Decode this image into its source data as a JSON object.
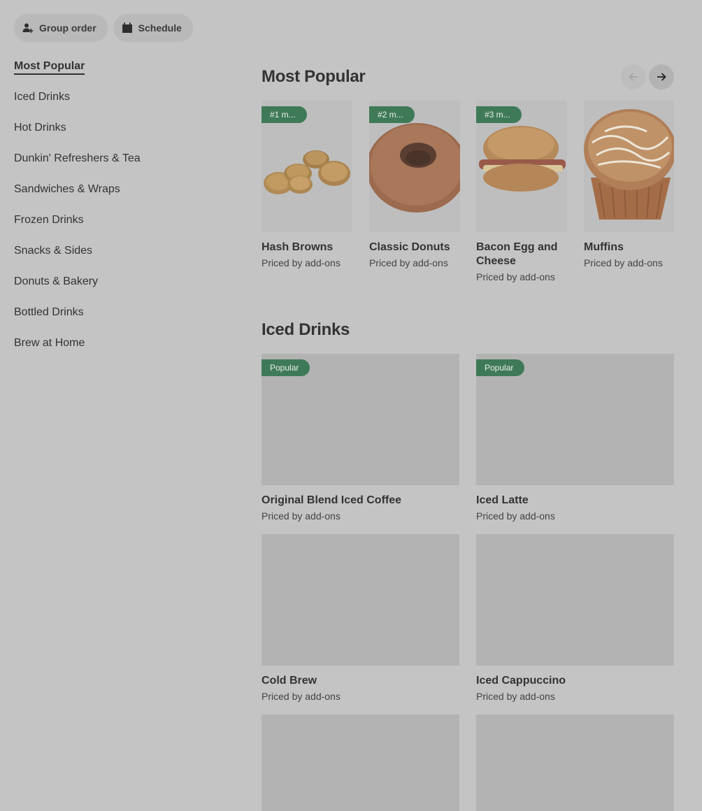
{
  "top_actions": {
    "group_order": "Group order",
    "schedule": "Schedule"
  },
  "sidebar": {
    "items": [
      {
        "label": "Most Popular"
      },
      {
        "label": "Iced Drinks"
      },
      {
        "label": "Hot Drinks"
      },
      {
        "label": "Dunkin' Refreshers & Tea"
      },
      {
        "label": "Sandwiches & Wraps"
      },
      {
        "label": "Frozen Drinks"
      },
      {
        "label": "Snacks & Sides"
      },
      {
        "label": "Donuts & Bakery"
      },
      {
        "label": "Bottled Drinks"
      },
      {
        "label": "Brew at Home"
      }
    ]
  },
  "most_popular": {
    "title": "Most Popular",
    "items": [
      {
        "badge": "#1 m...",
        "name": "Hash Browns",
        "price": "Priced by add-ons"
      },
      {
        "badge": "#2 m...",
        "name": "Classic Donuts",
        "price": "Priced by add-ons"
      },
      {
        "badge": "#3 m...",
        "name": "Bacon Egg and Cheese",
        "price": "Priced by add-ons"
      },
      {
        "badge": "",
        "name": "Muffins",
        "price": "Priced by add-ons"
      }
    ]
  },
  "iced_drinks": {
    "title": "Iced Drinks",
    "items": [
      {
        "badge": "Popular",
        "name": "Original Blend Iced Coffee",
        "price": "Priced by add-ons"
      },
      {
        "badge": "Popular",
        "name": "Iced Latte",
        "price": "Priced by add-ons"
      },
      {
        "badge": "",
        "name": "Cold Brew",
        "price": "Priced by add-ons"
      },
      {
        "badge": "",
        "name": "Iced Cappuccino",
        "price": "Priced by add-ons"
      }
    ]
  }
}
